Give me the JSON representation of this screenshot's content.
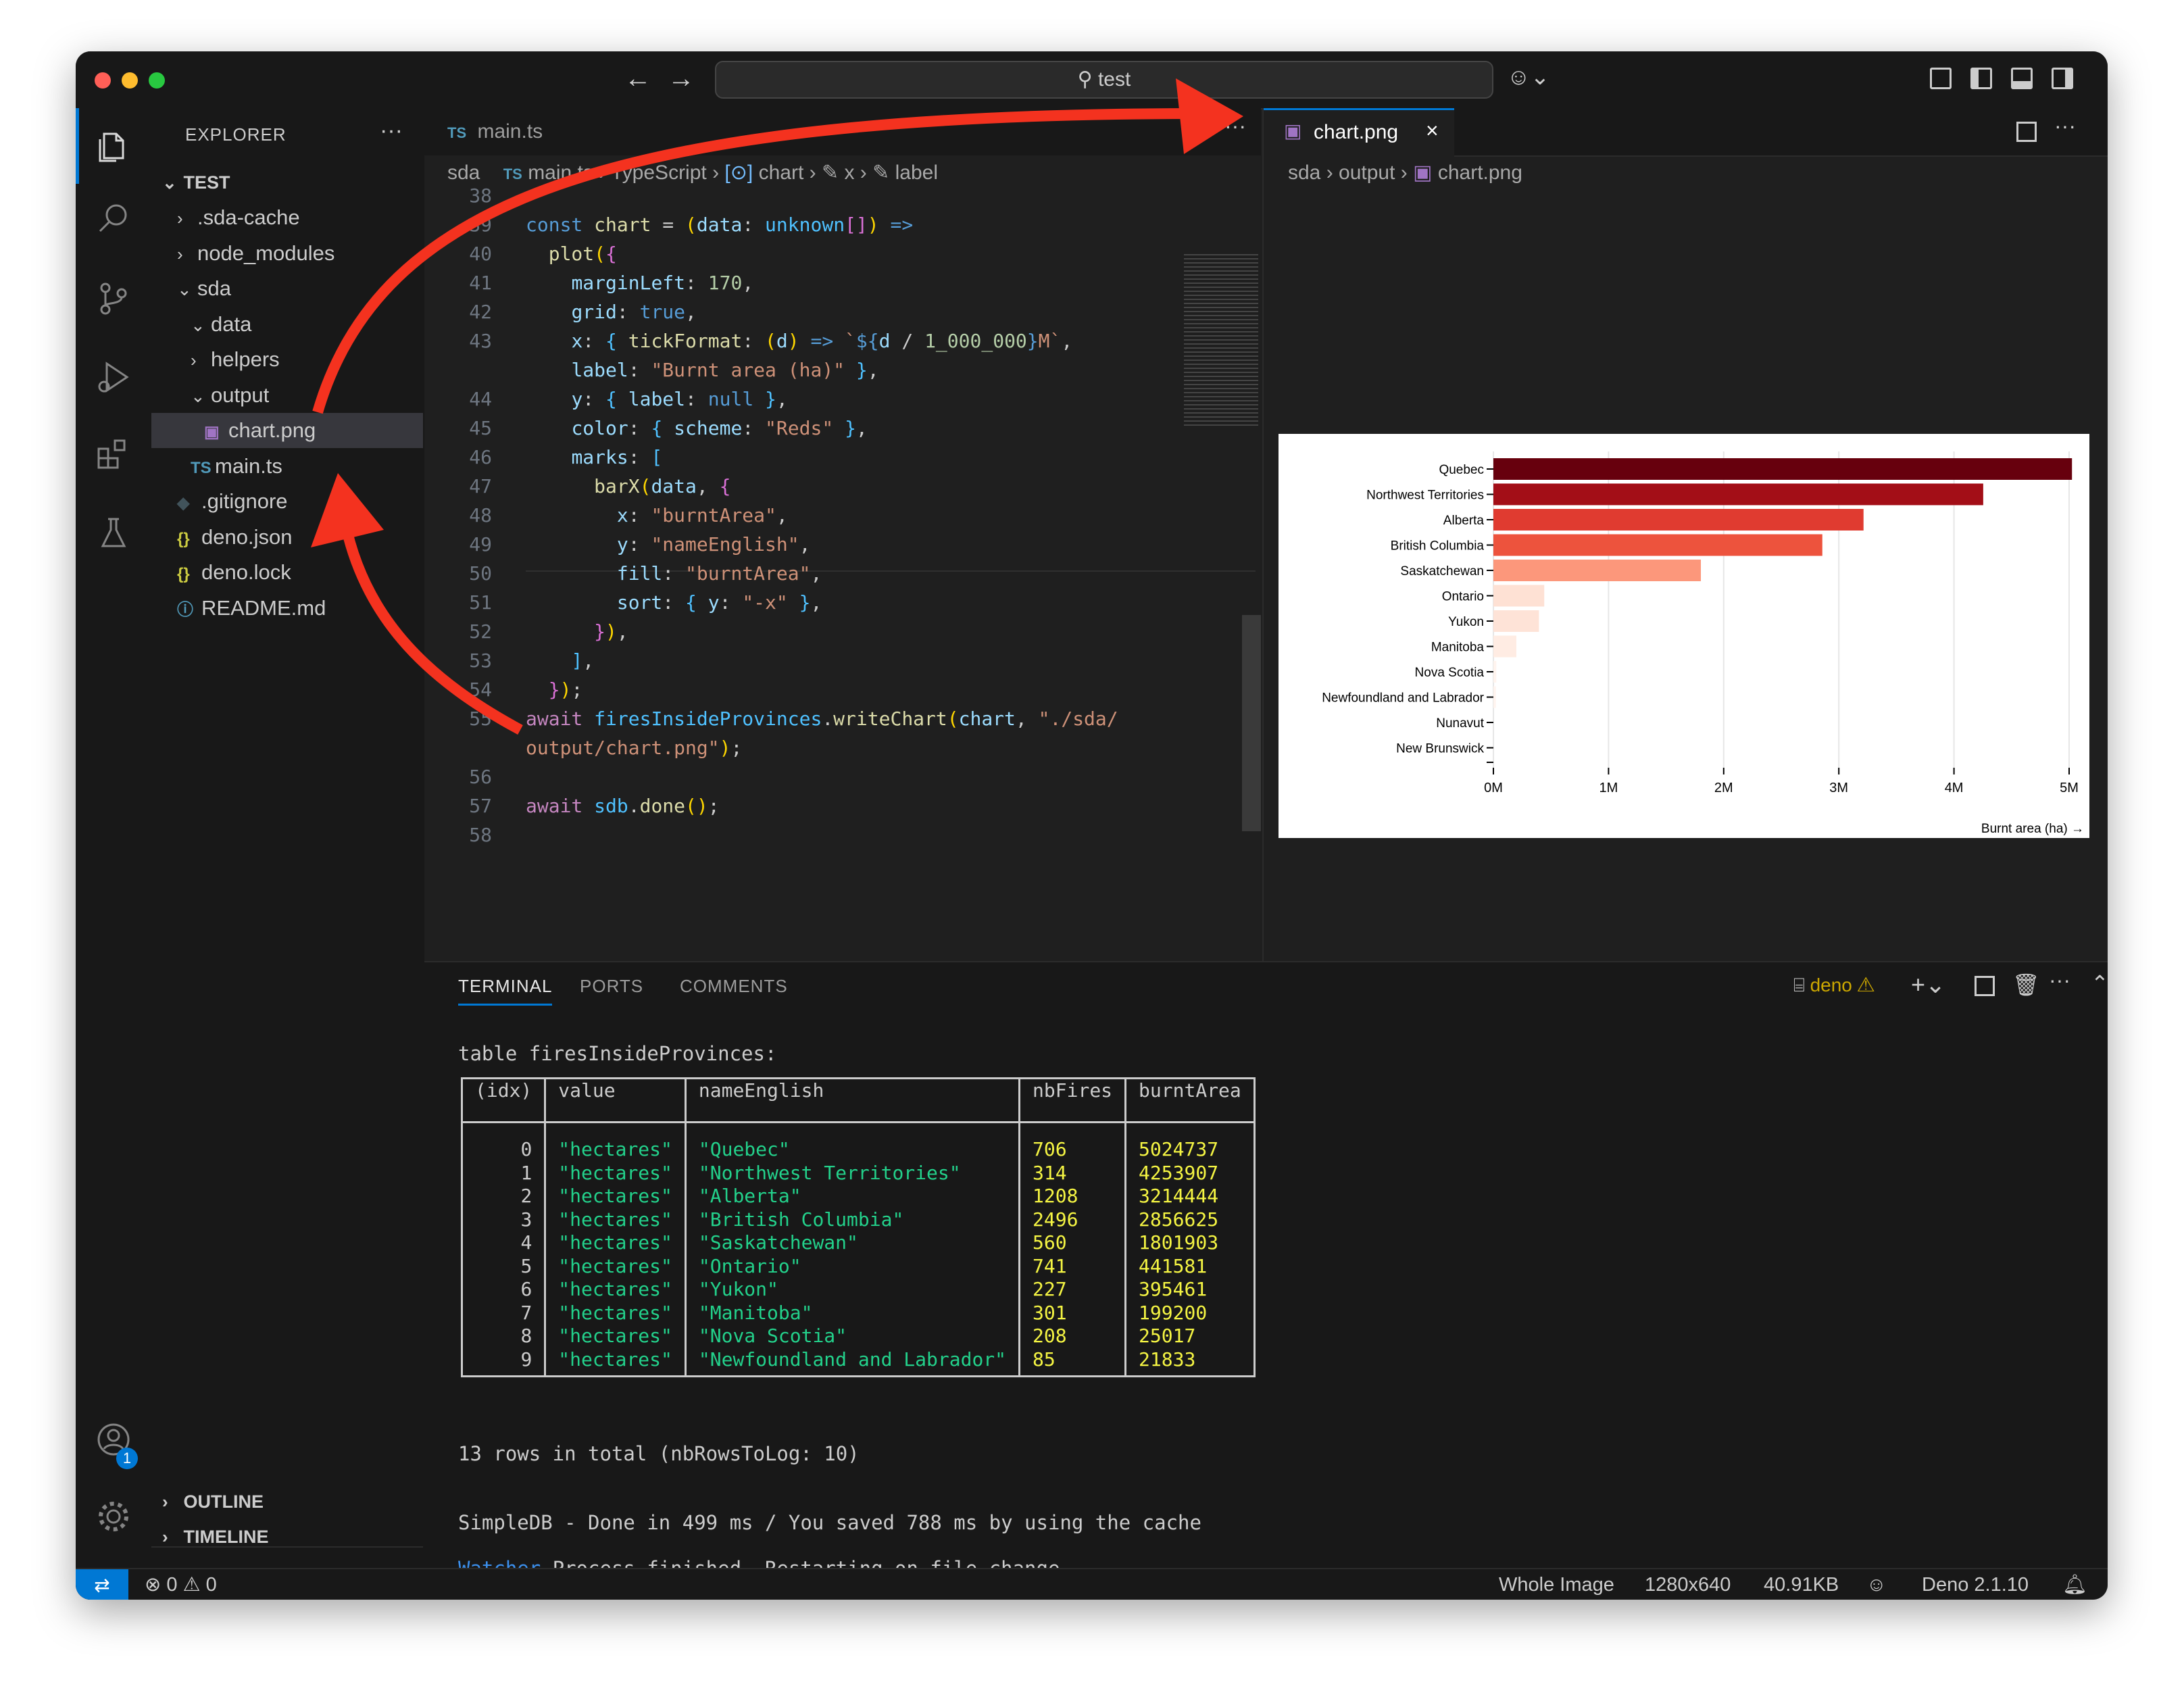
{
  "window": {
    "search_text": "test"
  },
  "sidebar": {
    "header": "EXPLORER",
    "root": "TEST",
    "items": [
      {
        "label": ".sda-cache",
        "indent": 1,
        "type": "folder",
        "open": false
      },
      {
        "label": "node_modules",
        "indent": 1,
        "type": "folder",
        "open": false
      },
      {
        "label": "sda",
        "indent": 1,
        "type": "folder",
        "open": true
      },
      {
        "label": "data",
        "indent": 2,
        "type": "folder",
        "open": true
      },
      {
        "label": "helpers",
        "indent": 2,
        "type": "folder",
        "open": false
      },
      {
        "label": "output",
        "indent": 2,
        "type": "folder",
        "open": true
      },
      {
        "label": "chart.png",
        "indent": 3,
        "type": "image",
        "selected": true
      },
      {
        "label": "main.ts",
        "indent": 2,
        "type": "ts"
      },
      {
        "label": ".gitignore",
        "indent": 1,
        "type": "git"
      },
      {
        "label": "deno.json",
        "indent": 1,
        "type": "json"
      },
      {
        "label": "deno.lock",
        "indent": 1,
        "type": "json"
      },
      {
        "label": "README.md",
        "indent": 1,
        "type": "info"
      }
    ],
    "outline": "OUTLINE",
    "timeline": "TIMELINE"
  },
  "editor": {
    "tab_label": "main.ts",
    "tab_prefix": "TS",
    "breadcrumb": {
      "folder": "sda",
      "file": "main.ts",
      "lang": "TypeScript",
      "symbol": "chart",
      "prop1": "x",
      "prop2": "label"
    },
    "line_numbers": [
      "38",
      "39",
      "40",
      "41",
      "42",
      "43",
      "",
      "44",
      "45",
      "46",
      "47",
      "48",
      "49",
      "50",
      "51",
      "52",
      "53",
      "54",
      "55",
      "",
      "56",
      "57",
      "58"
    ]
  },
  "preview": {
    "tab_label": "chart.png",
    "breadcrumb": {
      "folder": "sda",
      "sub": "output",
      "file": "chart.png"
    }
  },
  "chart_data": {
    "type": "bar",
    "orientation": "horizontal",
    "categories": [
      "Quebec",
      "Northwest Territories",
      "Alberta",
      "British Columbia",
      "Saskatchewan",
      "Ontario",
      "Yukon",
      "Manitoba",
      "Nova Scotia",
      "Newfoundland and Labrador",
      "Nunavut",
      "New Brunswick"
    ],
    "values": [
      5024737,
      4253907,
      3214444,
      2856625,
      1801903,
      441581,
      395461,
      199200,
      25017,
      21833,
      0,
      0
    ],
    "xlabel": "Burnt area (ha) →",
    "xlim": [
      0,
      5000000
    ],
    "ticks": [
      "0M",
      "1M",
      "2M",
      "3M",
      "4M",
      "5M"
    ],
    "color_scheme": "Reds",
    "grid": true
  },
  "panel": {
    "tabs": [
      "TERMINAL",
      "PORTS",
      "COMMENTS"
    ],
    "terminal_name": "deno",
    "table_title": "table firesInsideProvinces:",
    "columns": [
      "(idx)",
      "value",
      "nameEnglish",
      "nbFires",
      "burntArea"
    ],
    "rows": [
      [
        "0",
        "\"hectares\"",
        "\"Quebec\"",
        "706",
        "5024737"
      ],
      [
        "1",
        "\"hectares\"",
        "\"Northwest Territories\"",
        "314",
        "4253907"
      ],
      [
        "2",
        "\"hectares\"",
        "\"Alberta\"",
        "1208",
        "3214444"
      ],
      [
        "3",
        "\"hectares\"",
        "\"British Columbia\"",
        "2496",
        "2856625"
      ],
      [
        "4",
        "\"hectares\"",
        "\"Saskatchewan\"",
        "560",
        "1801903"
      ],
      [
        "5",
        "\"hectares\"",
        "\"Ontario\"",
        "741",
        "441581"
      ],
      [
        "6",
        "\"hectares\"",
        "\"Yukon\"",
        "227",
        "395461"
      ],
      [
        "7",
        "\"hectares\"",
        "\"Manitoba\"",
        "301",
        "199200"
      ],
      [
        "8",
        "\"hectares\"",
        "\"Nova Scotia\"",
        "208",
        "25017"
      ],
      [
        "9",
        "\"hectares\"",
        "\"Newfoundland and Labrador\"",
        "85",
        "21833"
      ]
    ],
    "total_line": "13 rows in total (nbRowsToLog: 10)",
    "done_line": "SimpleDB - Done in 499 ms / You saved 788 ms by using the cache",
    "watcher_label": "Watcher",
    "watcher_msg": " Process finished. Restarting on file change..."
  },
  "status": {
    "errors": "0",
    "warnings": "0",
    "whole_image": "Whole Image",
    "dims": "1280x640",
    "size": "40.91KB",
    "deno": "Deno 2.1.10",
    "badge": "1"
  }
}
